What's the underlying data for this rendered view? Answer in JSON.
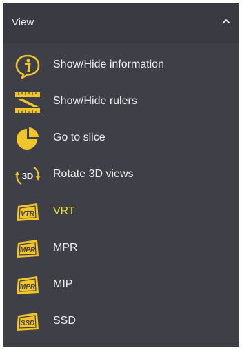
{
  "panel": {
    "title": "View",
    "collapse_icon": "chevron-up-icon"
  },
  "items": [
    {
      "label": "Show/Hide information",
      "icon": "info-icon"
    },
    {
      "label": "Show/Hide rulers",
      "icon": "rulers-icon"
    },
    {
      "label": "Go to slice",
      "icon": "pie-slice-icon"
    },
    {
      "label": "Rotate 3D views",
      "icon": "rotate-3d-icon"
    },
    {
      "label": "VRT",
      "icon": "vrt-icon",
      "active": true
    },
    {
      "label": "MPR",
      "icon": "mpr-icon"
    },
    {
      "label": "MIP",
      "icon": "mip-icon"
    },
    {
      "label": "SSD",
      "icon": "ssd-icon"
    }
  ],
  "colors": {
    "panel_bg": "#3f3f48",
    "header_bg": "#3a3a43",
    "icon_yellow": "#f2c52a",
    "text": "#ededed",
    "active_text": "#d8dd2b"
  }
}
